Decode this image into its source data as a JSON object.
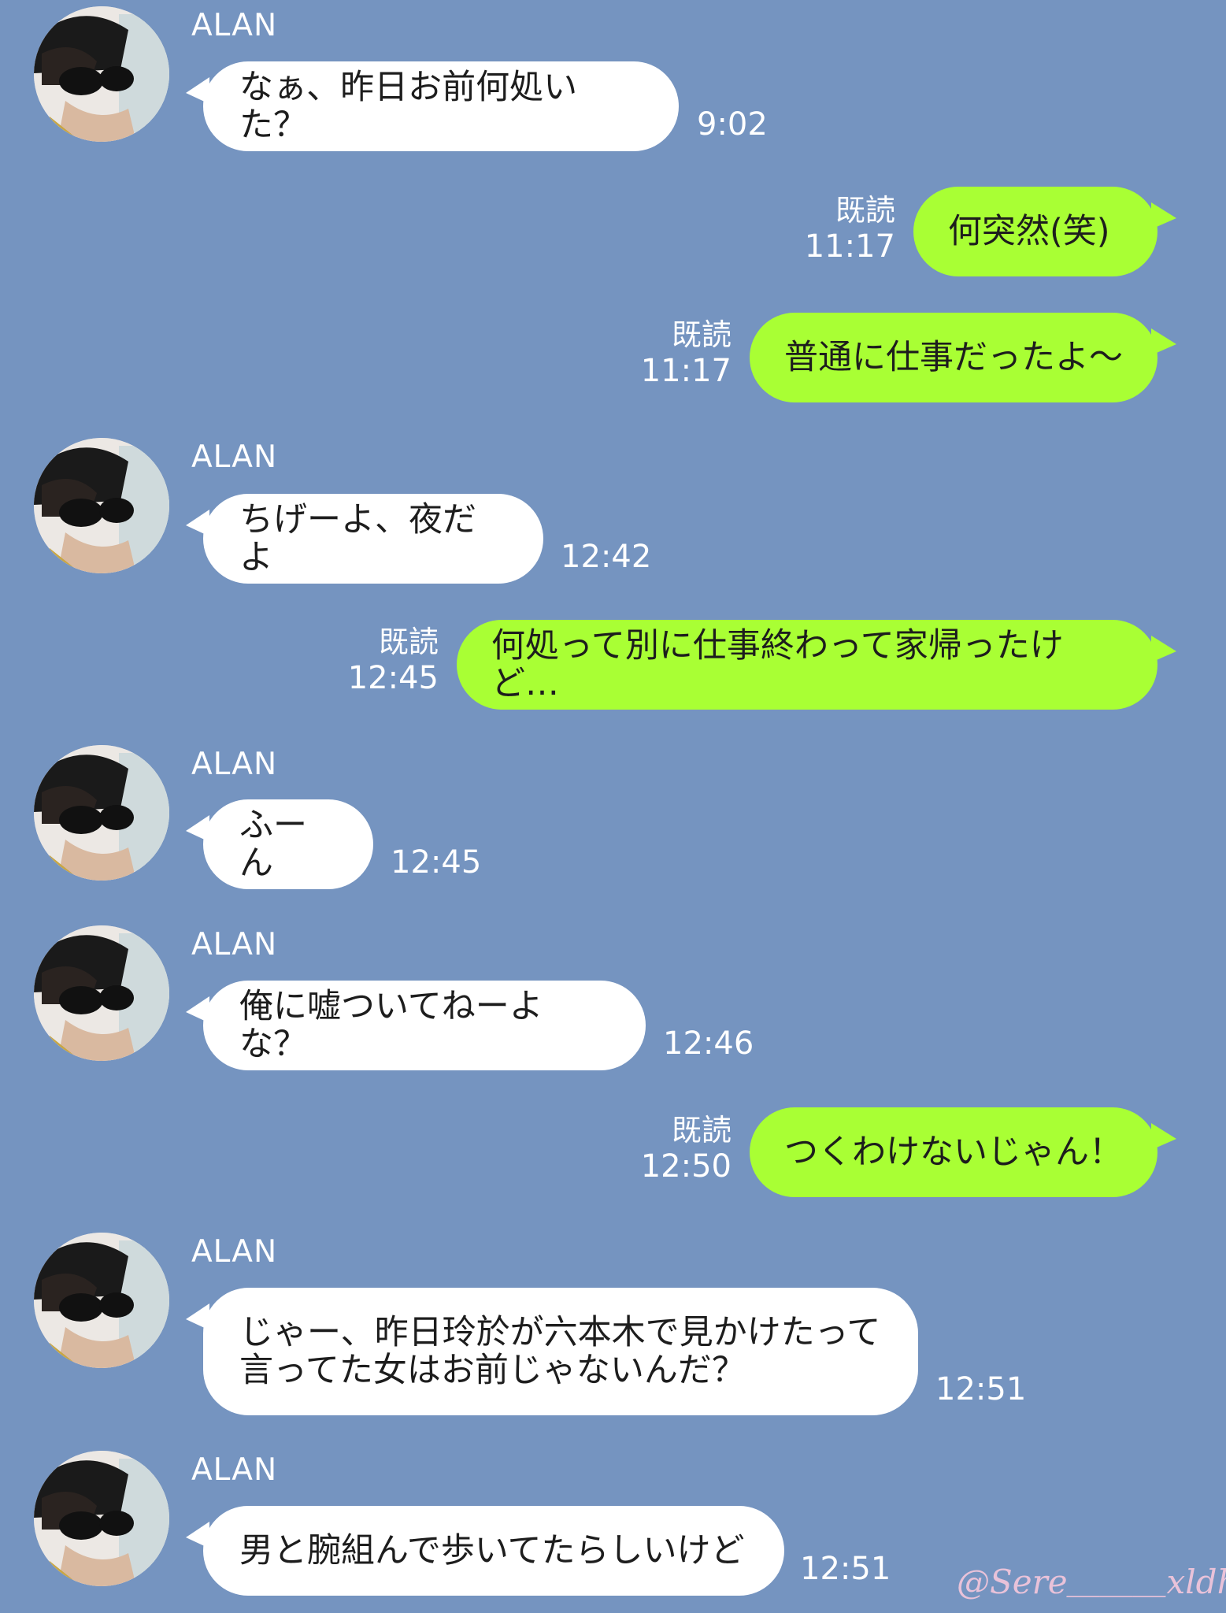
{
  "contact": {
    "name": "ALAN"
  },
  "messages": [
    {
      "side": "in",
      "text": "なぁ、昨日お前何処いた？",
      "time": "9:02"
    },
    {
      "side": "out",
      "text": "何突然(笑)",
      "read": "既読",
      "time": "11:17"
    },
    {
      "side": "out",
      "text": "普通に仕事だったよ〜",
      "read": "既読",
      "time": "11:17"
    },
    {
      "side": "in",
      "text": "ちげーよ、夜だよ",
      "time": "12:42"
    },
    {
      "side": "out",
      "text": "何処って別に仕事終わって家帰ったけど…",
      "read": "既読",
      "time": "12:45"
    },
    {
      "side": "in",
      "text": "ふーん",
      "time": "12:45"
    },
    {
      "side": "in",
      "text": "俺に嘘ついてねーよな？",
      "time": "12:46"
    },
    {
      "side": "out",
      "text": "つくわけないじゃん！",
      "read": "既読",
      "time": "12:50"
    },
    {
      "side": "in",
      "text": "じゃー、昨日玲於が六本木で見かけたって\n言ってた女はお前じゃないんだ？",
      "time": "12:51"
    },
    {
      "side": "in",
      "text": "男と腕組んで歩いてたらしいけど",
      "time": "12:51"
    }
  ],
  "watermark": "@Sere＿＿＿xldh",
  "colors": {
    "background": "#7594c0",
    "incoming_bubble": "#ffffff",
    "outgoing_bubble": "#a9ff34",
    "meta_text": "#ffffff"
  },
  "icons": {
    "avatar": "avatar-photo"
  }
}
